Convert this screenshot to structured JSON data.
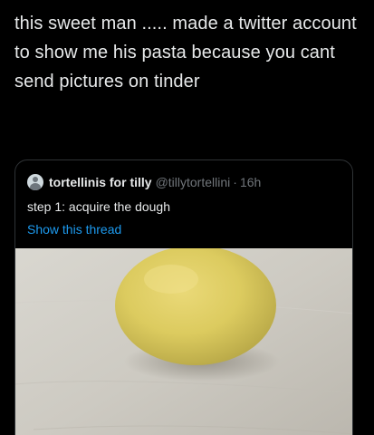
{
  "tweet": {
    "text": "this sweet man ..... made a twitter account to show me his pasta because you cant send pictures on tinder"
  },
  "quoted_tweet": {
    "avatar_icon": "default-avatar-icon",
    "display_name": "tortellinis for tilly",
    "handle": "@tillytortellini",
    "separator": "·",
    "time": "16h",
    "text": "step 1: acquire the dough",
    "show_thread_label": "Show this thread",
    "image": "dough-ball-photo"
  },
  "colors": {
    "background": "#000000",
    "text": "#e7e9ea",
    "secondary_text": "#71767b",
    "link": "#1d9bf0",
    "card_border": "#2f3336",
    "dough": "#ddd06a"
  }
}
